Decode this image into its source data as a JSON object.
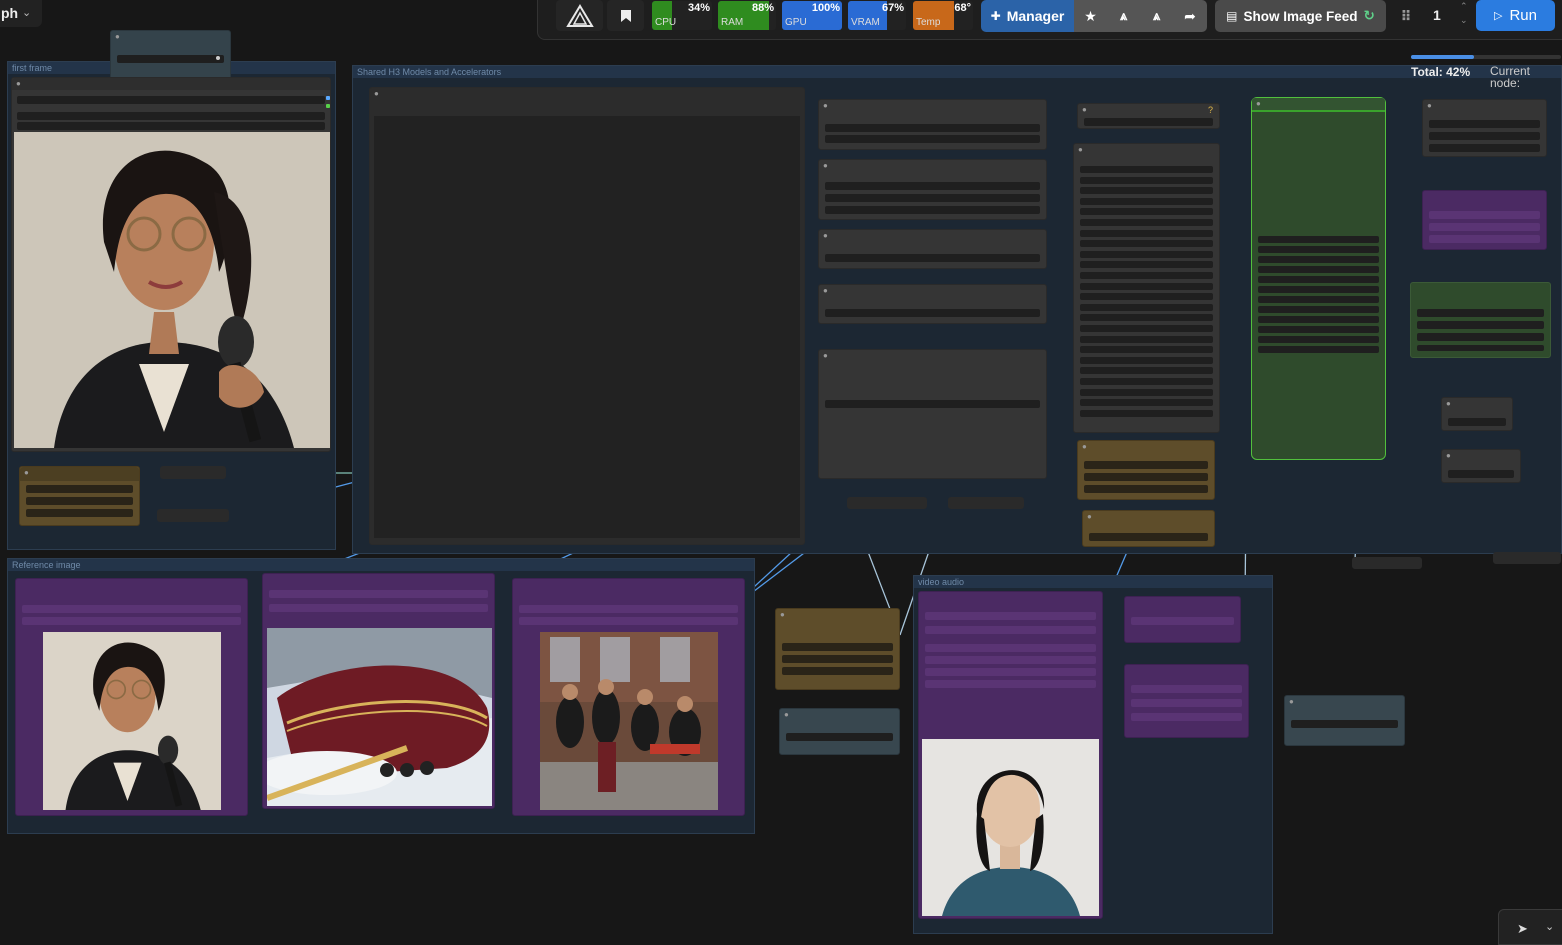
{
  "topbar": {
    "workflow_tab": "ph",
    "stats": [
      {
        "label": "CPU",
        "value": "34%",
        "color": "#2f8c1f",
        "fraction": 0.34
      },
      {
        "label": "RAM",
        "value": "88%",
        "color": "#2f8c1f",
        "fraction": 0.88
      },
      {
        "label": "GPU",
        "value": "100%",
        "color": "#2a6bd4",
        "fraction": 1.0
      },
      {
        "label": "VRAM",
        "value": "67%",
        "color": "#2a6bd4",
        "fraction": 0.67
      },
      {
        "label": "Temp",
        "value": "68°",
        "color": "#c8681a",
        "fraction": 0.68
      }
    ],
    "manager_label": "Manager",
    "image_feed_label": "Show Image Feed",
    "queue_count": "1",
    "run_label": "Run",
    "progress": {
      "total_label": "Total: 42%",
      "total_fraction": 0.42,
      "current_label": "Current node:"
    }
  },
  "groups": {
    "first_frame": "first frame",
    "shared_models": "Shared H3 Models and Accelerators",
    "reference_image": "Reference image",
    "video_audio": "video audio"
  },
  "colors": {
    "canvas": "#171717",
    "group": "#1c2733",
    "node": "#353535",
    "purple_node": "#4b2a63",
    "brown_node": "#5e4d2a",
    "green_node": "#2f4b2c",
    "accent_blue": "#2b7ce0",
    "link_blue": "#5aa9ff"
  },
  "icons": [
    "comfy-logo-icon",
    "bookmark-icon",
    "puzzle-icon",
    "star-icon",
    "cluster-icon",
    "share-icon",
    "image-feed-icon",
    "drag-handle-icon",
    "play-icon",
    "pointer-icon",
    "chevron-down-icon"
  ]
}
